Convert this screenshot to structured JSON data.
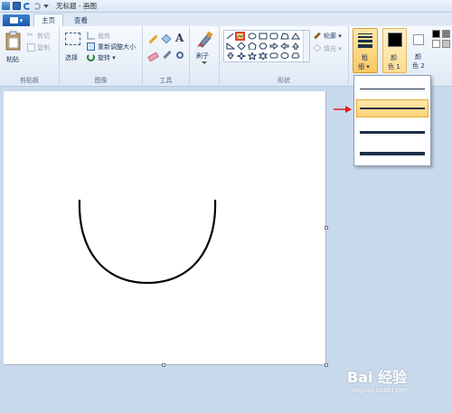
{
  "titlebar": {
    "title": "无标题 - 画图"
  },
  "tabs": {
    "file": "▾",
    "home": "主页",
    "view": "查看"
  },
  "clipboard": {
    "paste": "粘贴",
    "cut": "剪切",
    "copy": "复制",
    "label": "剪贴板"
  },
  "image": {
    "select": "选择",
    "crop": "裁剪",
    "resize": "重新调整大小",
    "rotate": "旋转 ▾",
    "label": "图像"
  },
  "tools": {
    "text": "A",
    "label": "工具"
  },
  "brushes": {
    "label": "刷子"
  },
  "shapes": {
    "outline": "轮廓 ▾",
    "fill": "填充 ▾",
    "label": "形状"
  },
  "size": {
    "label_line1": "粗",
    "label_line2": "细 ▾"
  },
  "color1": {
    "label_line1": "颜",
    "label_line2": "色 1"
  },
  "color2": {
    "label_line1": "颜",
    "label_line2": "色 2"
  },
  "palette": [
    "#000000",
    "#7f7f7f",
    "#ffffff",
    "#c3c3c3"
  ],
  "canvas": {
    "background": "#ffffff",
    "stroke": "#000000"
  },
  "size_options": [
    {
      "name": "1px"
    },
    {
      "name": "3px",
      "selected": true
    },
    {
      "name": "5px"
    },
    {
      "name": "8px"
    }
  ],
  "watermark": {
    "main": "Bai 经验",
    "sub": "jingyan.baidu.com"
  }
}
